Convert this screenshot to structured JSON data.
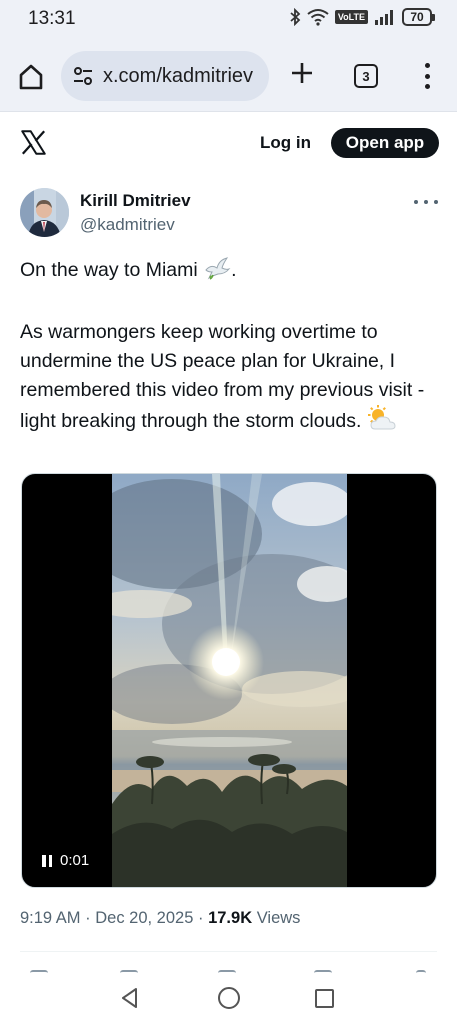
{
  "status_bar": {
    "time": "13:31",
    "volte": "VoLTE",
    "battery": "70",
    "icons": [
      "bluetooth-icon",
      "wifi-icon",
      "signal-icon",
      "battery-icon"
    ]
  },
  "browser": {
    "url": "x.com/kadmitriev",
    "tab_count": "3"
  },
  "header": {
    "login_label": "Log in",
    "open_app_label": "Open app"
  },
  "tweet": {
    "author_name": "Kirill Dmitriev",
    "author_handle": "@kadmitriev",
    "line1": "On the way to Miami",
    "line1_emoji": "🕊",
    "line2": "As warmongers keep working overtime to undermine the US peace plan for Ukraine, I remembered this video from my previous visit - light breaking through the storm clouds.",
    "line2_emoji": "⛅",
    "video_time": "0:01",
    "time": "9:19 AM",
    "date": "Dec 20, 2025",
    "views_count": "17.9K",
    "views_label": "Views"
  },
  "colors": {
    "brand_black": "#0f1419",
    "secondary_text": "#536471",
    "browser_chrome": "#eef1f7"
  }
}
